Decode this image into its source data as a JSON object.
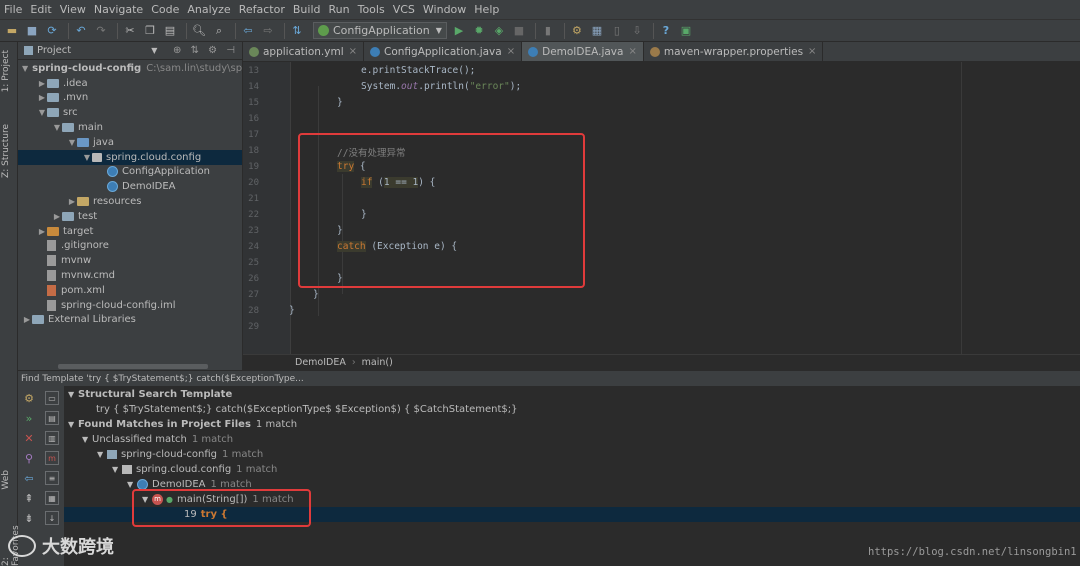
{
  "menu": [
    "File",
    "Edit",
    "View",
    "Navigate",
    "Code",
    "Analyze",
    "Refactor",
    "Build",
    "Run",
    "Tools",
    "VCS",
    "Window",
    "Help"
  ],
  "toolbar": {
    "run_config": "ConfigApplication"
  },
  "side_tabs": {
    "project": "1: Project",
    "structure": "Z: Structure",
    "web": "Web",
    "favorites": "2: Favorites"
  },
  "project": {
    "title": "Project",
    "tree": [
      {
        "label": "spring-cloud-config",
        "path": "C:\\sam.lin\\study\\sprin",
        "depth": 0,
        "arrow": "▼",
        "icon": "folder"
      },
      {
        "label": ".idea",
        "depth": 1,
        "arrow": "▶",
        "icon": "folder"
      },
      {
        "label": ".mvn",
        "depth": 1,
        "arrow": "▶",
        "icon": "folder"
      },
      {
        "label": "src",
        "depth": 1,
        "arrow": "▼",
        "icon": "folder"
      },
      {
        "label": "main",
        "depth": 2,
        "arrow": "▼",
        "icon": "folder"
      },
      {
        "label": "java",
        "depth": 3,
        "arrow": "▼",
        "icon": "src"
      },
      {
        "label": "spring.cloud.config",
        "depth": 4,
        "arrow": "▼",
        "icon": "pkg",
        "selected": true
      },
      {
        "label": "ConfigApplication",
        "depth": 5,
        "arrow": "",
        "icon": "class"
      },
      {
        "label": "DemoIDEA",
        "depth": 5,
        "arrow": "",
        "icon": "class"
      },
      {
        "label": "resources",
        "depth": 3,
        "arrow": "▶",
        "icon": "res"
      },
      {
        "label": "test",
        "depth": 2,
        "arrow": "▶",
        "icon": "folder"
      },
      {
        "label": "target",
        "depth": 1,
        "arrow": "▶",
        "icon": "target"
      },
      {
        "label": ".gitignore",
        "depth": 1,
        "arrow": "",
        "icon": "file"
      },
      {
        "label": "mvnw",
        "depth": 1,
        "arrow": "",
        "icon": "file"
      },
      {
        "label": "mvnw.cmd",
        "depth": 1,
        "arrow": "",
        "icon": "file"
      },
      {
        "label": "pom.xml",
        "depth": 1,
        "arrow": "",
        "icon": "mvn"
      },
      {
        "label": "spring-cloud-config.iml",
        "depth": 1,
        "arrow": "",
        "icon": "file"
      },
      {
        "label": "External Libraries",
        "depth": 0,
        "arrow": "▶",
        "icon": "lib"
      }
    ]
  },
  "tabs": [
    {
      "label": "application.yml",
      "active": false,
      "color": "#6a8759"
    },
    {
      "label": "ConfigApplication.java",
      "active": false,
      "color": "#3d7eb5"
    },
    {
      "label": "DemoIDEA.java",
      "active": true,
      "color": "#3d7eb5"
    },
    {
      "label": "maven-wrapper.properties",
      "active": false,
      "color": "#9a7a4a"
    }
  ],
  "editor": {
    "line_numbers": [
      "13",
      "14",
      "15",
      "16",
      "17",
      "18",
      "19",
      "20",
      "21",
      "22",
      "23",
      "24",
      "25",
      "26",
      "27",
      "28",
      "29"
    ],
    "lines": {
      "l13_a": "e.printStackTrace();",
      "l14_a": "System.",
      "l14_b": "out",
      "l14_c": ".println(",
      "l14_d": "\"error\"",
      "l14_e": ");",
      "l15": "}",
      "l18": "//没有处理异常",
      "l19_a": "try",
      "l19_b": " {",
      "l20_a": "if",
      "l20_b": " (",
      "l20_c": "1 == 1",
      "l20_d": ") {",
      "l22": "}",
      "l23": "}",
      "l24_a": "catch",
      "l24_b": " (Exception e) {",
      "l26": "}",
      "l27": "}",
      "l28": "}"
    }
  },
  "breadcrumb": {
    "class": "DemoIDEA",
    "method": "main()"
  },
  "find": {
    "header": "Find Template 'try {  $TryStatement$;} catch($ExceptionType...",
    "rows": {
      "template_title": "Structural Search Template",
      "template_text": "try {  $TryStatement$;} catch($ExceptionType$ $Exception$) {  $CatchStatement$;}",
      "found": "Found Matches in Project Files",
      "found_cnt": "1 match",
      "unclassified": "Unclassified match",
      "unclassified_cnt": "1 match",
      "module": "spring-cloud-config",
      "module_cnt": "1 match",
      "pkg": "spring.cloud.config",
      "pkg_cnt": "1 match",
      "cls": "DemoIDEA",
      "cls_cnt": "1 match",
      "method": "main(String[])",
      "method_cnt": "1 match",
      "line_no": "19",
      "line_code": "try {"
    }
  },
  "watermark": {
    "brand": "大数跨境",
    "url": "https://blog.csdn.net/linsongbin1"
  }
}
